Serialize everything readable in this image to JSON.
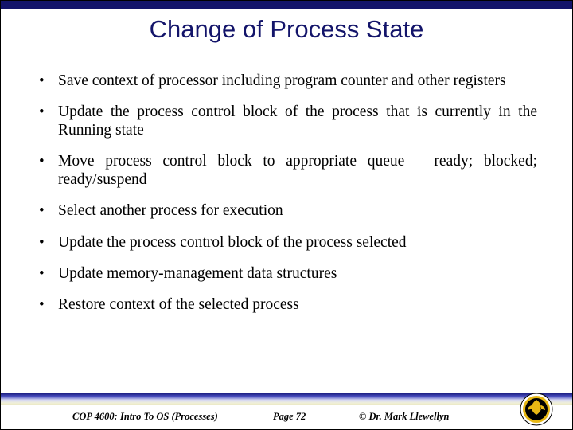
{
  "title": "Change of Process State",
  "bullets": [
    {
      "text": "Save context of processor including program counter and other registers",
      "justify": false
    },
    {
      "text": "Update the process control block of the process that is currently in the Running state",
      "justify": true
    },
    {
      "text": "Move process control block to appropriate queue – ready; blocked; ready/suspend",
      "justify": true
    },
    {
      "text": "Select another process for execution",
      "justify": false
    },
    {
      "text": "Update the process control block of the process selected",
      "justify": false
    },
    {
      "text": "Update memory-management data structures",
      "justify": false
    },
    {
      "text": "Restore context of the selected process",
      "justify": false
    }
  ],
  "footer": {
    "course": "COP 4600: Intro To OS  (Processes)",
    "page": "Page 72",
    "author": "© Dr. Mark Llewellyn"
  },
  "logo": {
    "name": "ucf-pegasus-logo"
  }
}
